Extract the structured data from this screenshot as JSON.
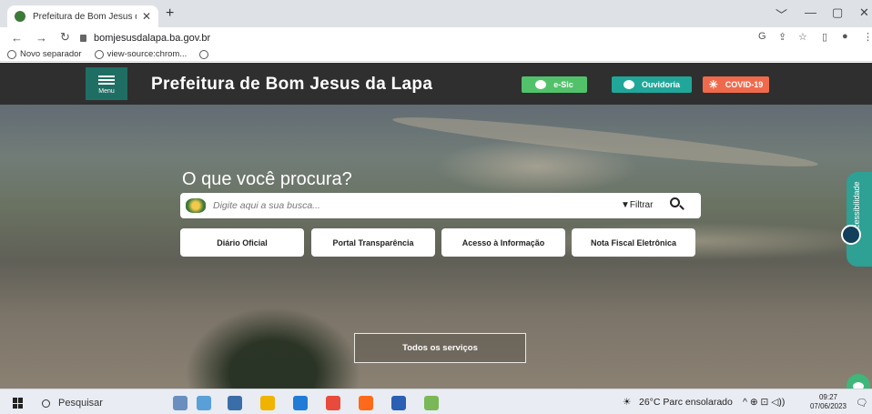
{
  "browser": {
    "tab_title": "Prefeitura de Bom Jesus da Lapa",
    "tab_close": "✕",
    "new_tab": "+",
    "url": "bomjesusdalapa.ba.gov.br",
    "window_controls": [
      "﹀",
      "—",
      "▢",
      "✕"
    ],
    "nav": {
      "back": "←",
      "forward": "→",
      "reload": "↻"
    },
    "right_icons": [
      "G",
      "⇪",
      "☆",
      "▯",
      "●",
      "⋮"
    ],
    "bookmarks": [
      "Novo separador",
      "view-source:chrom...",
      ""
    ]
  },
  "header": {
    "menu_label": "Menu",
    "title": "Prefeitura de Bom Jesus da Lapa",
    "buttons": [
      {
        "label": "e-Sic",
        "color": "#52c26a"
      },
      {
        "label": "Ouvidoria",
        "color": "#20a79a"
      },
      {
        "label": "COVID-19",
        "color": "#ef6a4c"
      }
    ]
  },
  "hero": {
    "title": "O que você procura?",
    "search_placeholder": "Digite aqui a sua busca...",
    "filter_label": "▼Filtrar",
    "quick_links": [
      "Diário Oficial",
      "Portal Transparência",
      "Acesso à Informação",
      "Nota Fiscal Eletrônica"
    ],
    "all_services": "Todos os serviços",
    "accessibility_label": "Acessibilidade"
  },
  "taskbar": {
    "search_label": "Pesquisar",
    "weather": "26°C  Parc ensolarado",
    "tray": "^  ⊕  ⊡  ◁))",
    "time": "09:27",
    "date": "07/06/2023",
    "app_colors": [
      "#6a8fbf",
      "#5aa0d8",
      "#3a6ea8",
      "#f0b400",
      "#1f7bd6",
      "#e84b3c",
      "#ff6a1a",
      "#2b5fb3",
      "#7ab857"
    ]
  }
}
